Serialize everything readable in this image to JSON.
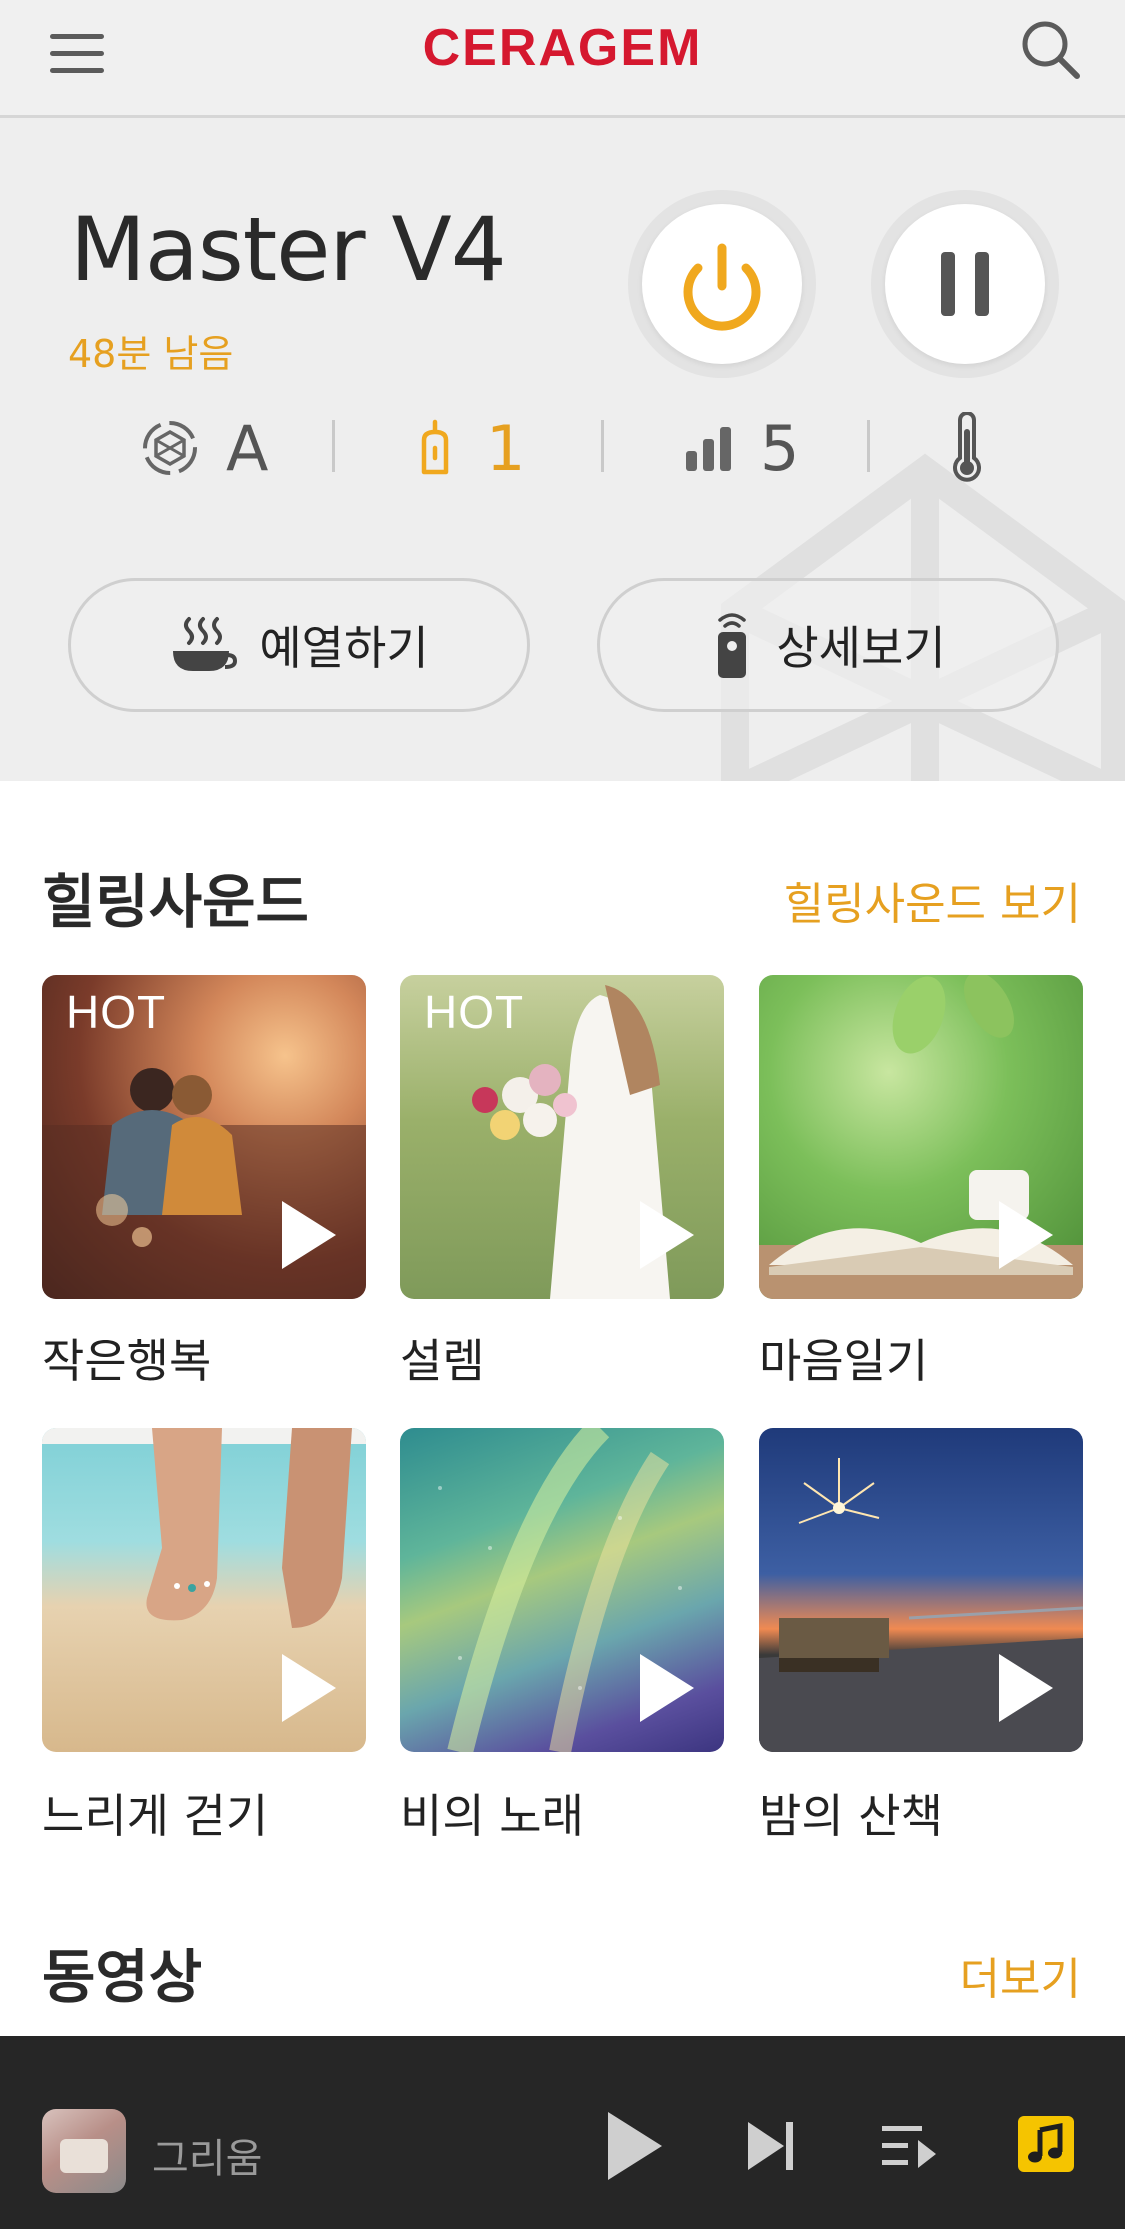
{
  "header": {
    "brand": "CERAGEM",
    "menu_icon": "hamburger-menu-icon",
    "search_icon": "search-icon"
  },
  "device": {
    "name": "Master V4",
    "remaining": "48분 남음",
    "status": {
      "mode": "A",
      "posture": "1",
      "intensity": "5"
    },
    "preheat_label": "예열하기",
    "detail_label": "상세보기"
  },
  "healing_sound": {
    "title": "힐링사운드",
    "link": "힐링사운드 보기",
    "items": [
      {
        "title": "작은행복",
        "badge": "HOT"
      },
      {
        "title": "설렘",
        "badge": "HOT"
      },
      {
        "title": "마음일기",
        "badge": ""
      },
      {
        "title": "느리게 걷기",
        "badge": ""
      },
      {
        "title": "비의 노래",
        "badge": ""
      },
      {
        "title": "밤의 산책",
        "badge": ""
      }
    ]
  },
  "video": {
    "title": "동영상",
    "link": "더보기"
  },
  "player": {
    "track": "그리움"
  },
  "colors": {
    "brand": "#d5182f",
    "accent": "#e6a020",
    "player_bg": "#262626",
    "music_active": "#f5c400"
  }
}
